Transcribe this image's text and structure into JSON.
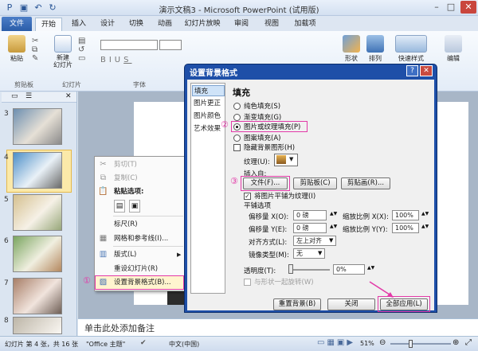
{
  "window": {
    "title": "演示文稿3 - Microsoft PowerPoint (试用版)"
  },
  "tabs": [
    "文件",
    "开始",
    "插入",
    "设计",
    "切换",
    "动画",
    "幻灯片放映",
    "审阅",
    "视图",
    "加载项"
  ],
  "ribbon": {
    "paste": "粘贴",
    "new_slide": "新建\n幻灯片",
    "clipboard_group": "剪贴板",
    "slides_group": "幻灯片",
    "font_group": "字体",
    "shapes": "形状",
    "arrange": "排列",
    "quick_styles": "快速样式",
    "edit": "编辑"
  },
  "thumbnails": [
    "3",
    "4",
    "5",
    "6",
    "7",
    "8"
  ],
  "context_menu": {
    "items": [
      "剪切(T)",
      "复制(C)",
      "粘贴选项:",
      "标尺(R)",
      "网格和参考线(I)...",
      "版式(L)",
      "重设幻灯片(R)",
      "设置背景格式(B)..."
    ]
  },
  "dialog": {
    "title": "设置背景格式",
    "nav": [
      "填充",
      "图片更正",
      "图片颜色",
      "艺术效果"
    ],
    "section_title": "填充",
    "radios": [
      "纯色填充(S)",
      "渐变填充(G)",
      "图片或纹理填充(P)",
      "图案填充(A)"
    ],
    "hide_bg": "隐藏背景图形(H)",
    "texture_label": "纹理(U):",
    "insert_from": "插入自:",
    "btn_file": "文件(F)...",
    "btn_clipboard": "剪贴板(C)",
    "btn_clipart": "剪贴画(R)...",
    "tile_check": "将图片平铺为纹理(I)",
    "tile_options": "平铺选项",
    "offset_x_label": "偏移量 X(O):",
    "offset_x": "0 磅",
    "scale_x_label": "缩放比例 X(X):",
    "scale_x": "100%",
    "offset_y_label": "偏移量 Y(E):",
    "offset_y": "0 磅",
    "scale_y_label": "缩放比例 Y(Y):",
    "scale_y": "100%",
    "align_label": "对齐方式(L):",
    "align_value": "左上对齐",
    "mirror_label": "镜像类型(M):",
    "mirror_value": "无",
    "transparency_label": "透明度(T):",
    "transparency_value": "0%",
    "rotate_with_shape": "与形状一起旋转(W)",
    "btn_reset": "重置背景(B)",
    "btn_close": "关闭",
    "btn_apply_all": "全部应用(L)"
  },
  "annotations": {
    "c1": "①",
    "c2": "②",
    "c3": "③"
  },
  "notes": "单击此处添加备注",
  "status": {
    "slide_info": "幻灯片 第 4 张，共 16 张",
    "theme": "\"Office 主题\"",
    "lang": "中文(中国)",
    "zoom": "51%"
  },
  "colors": {
    "accent": "#e23aa8",
    "dialog_frame": "#1e4fa8",
    "file_tab": "#2a5ca8"
  }
}
